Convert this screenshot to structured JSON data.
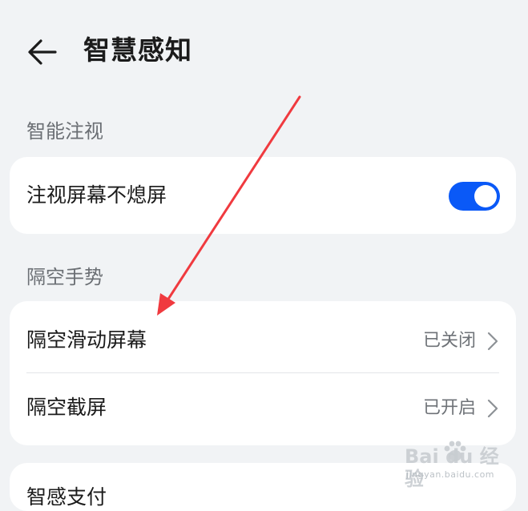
{
  "header": {
    "title": "智慧感知",
    "back_icon": "arrow-left-icon"
  },
  "sections": {
    "gaze": {
      "label": "智能注视",
      "rows": [
        {
          "label": "注视屏幕不熄屏",
          "toggle_on": true
        }
      ]
    },
    "air_gesture": {
      "label": "隔空手势",
      "rows": [
        {
          "label": "隔空滑动屏幕",
          "value": "已关闭"
        },
        {
          "label": "隔空截屏",
          "value": "已开启"
        }
      ]
    },
    "next": {
      "rows": [
        {
          "label": "智感支付"
        }
      ]
    }
  },
  "colors": {
    "background": "#f1f3f5",
    "card": "#ffffff",
    "accent": "#0a59f7",
    "annotation_arrow": "#f03a3f"
  },
  "watermark": {
    "brand": "Bai du 经验",
    "url": "jingyan.baidu.com"
  }
}
